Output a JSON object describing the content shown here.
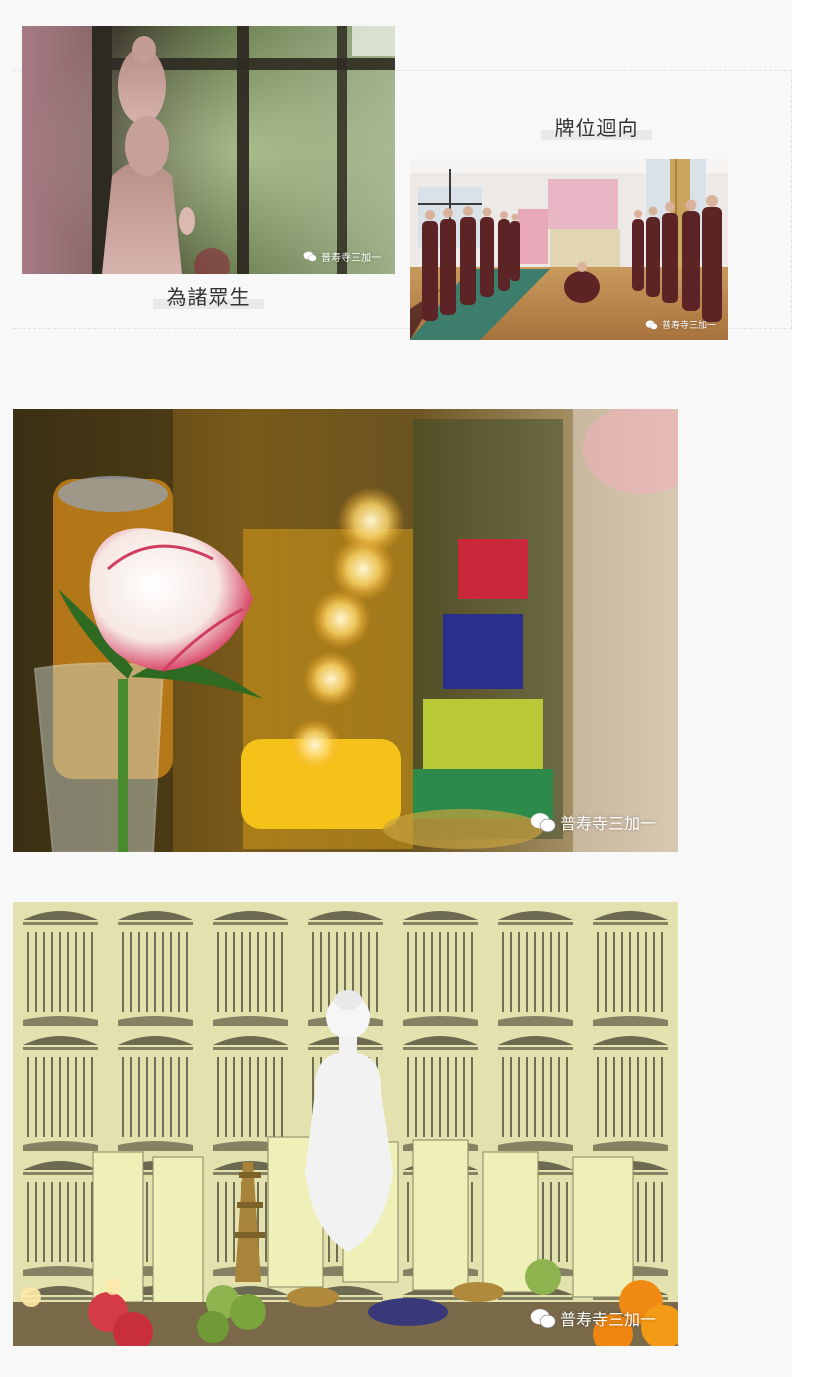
{
  "section_one": {
    "caption_left": "為諸眾生",
    "caption_right": "牌位迴向",
    "watermark_small": "普寿寺三加一"
  },
  "photos": {
    "guanyin": {
      "alt": "為諸眾生",
      "watermark": "普寿寺三加一"
    },
    "memorial_hall": {
      "alt": "牌位迴向",
      "watermark": "普寿寺三加一"
    },
    "rose_candles": {
      "watermark": "普寿寺三加一"
    },
    "buddha_tablets": {
      "watermark": "普寿寺三加一"
    }
  },
  "colors": {
    "page_bg": "#f8f8f8",
    "caption_text": "#333333",
    "caption_highlight": "#e9e9e9"
  }
}
